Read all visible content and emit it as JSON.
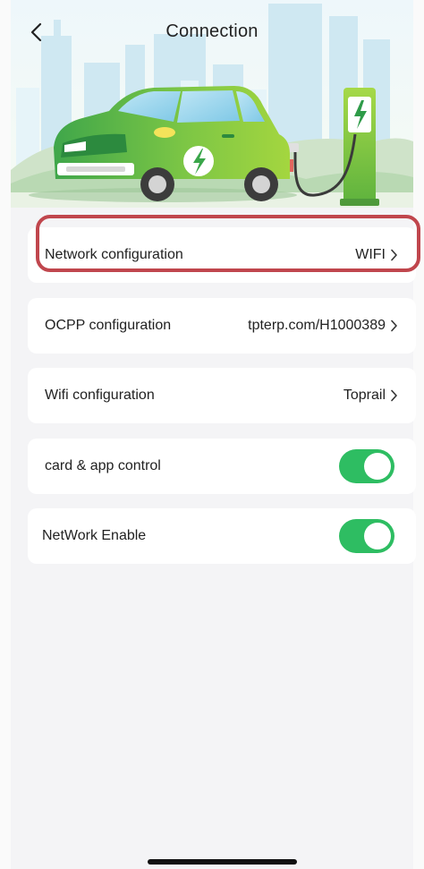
{
  "header": {
    "title": "Connection"
  },
  "settings": [
    {
      "label": "Network configuration",
      "value": "WIFI"
    },
    {
      "label": "OCPP configuration",
      "value": "tpterp.com/H1000389"
    },
    {
      "label": "Wifi configuration",
      "value": "Toprail"
    }
  ],
  "toggles": [
    {
      "label": "card & app control",
      "state": "on"
    },
    {
      "label": "NetWork Enable",
      "state": "on"
    }
  ],
  "colors": {
    "toggle_on": "#2ebd62",
    "highlight_border": "#c0464d",
    "car_green": "#6cc04a",
    "background": "#f4f4f6"
  },
  "icons": {
    "back": "chevron-left-icon",
    "disclosure": "chevron-right-icon",
    "charger_bolt": "lightning-bolt-icon"
  }
}
